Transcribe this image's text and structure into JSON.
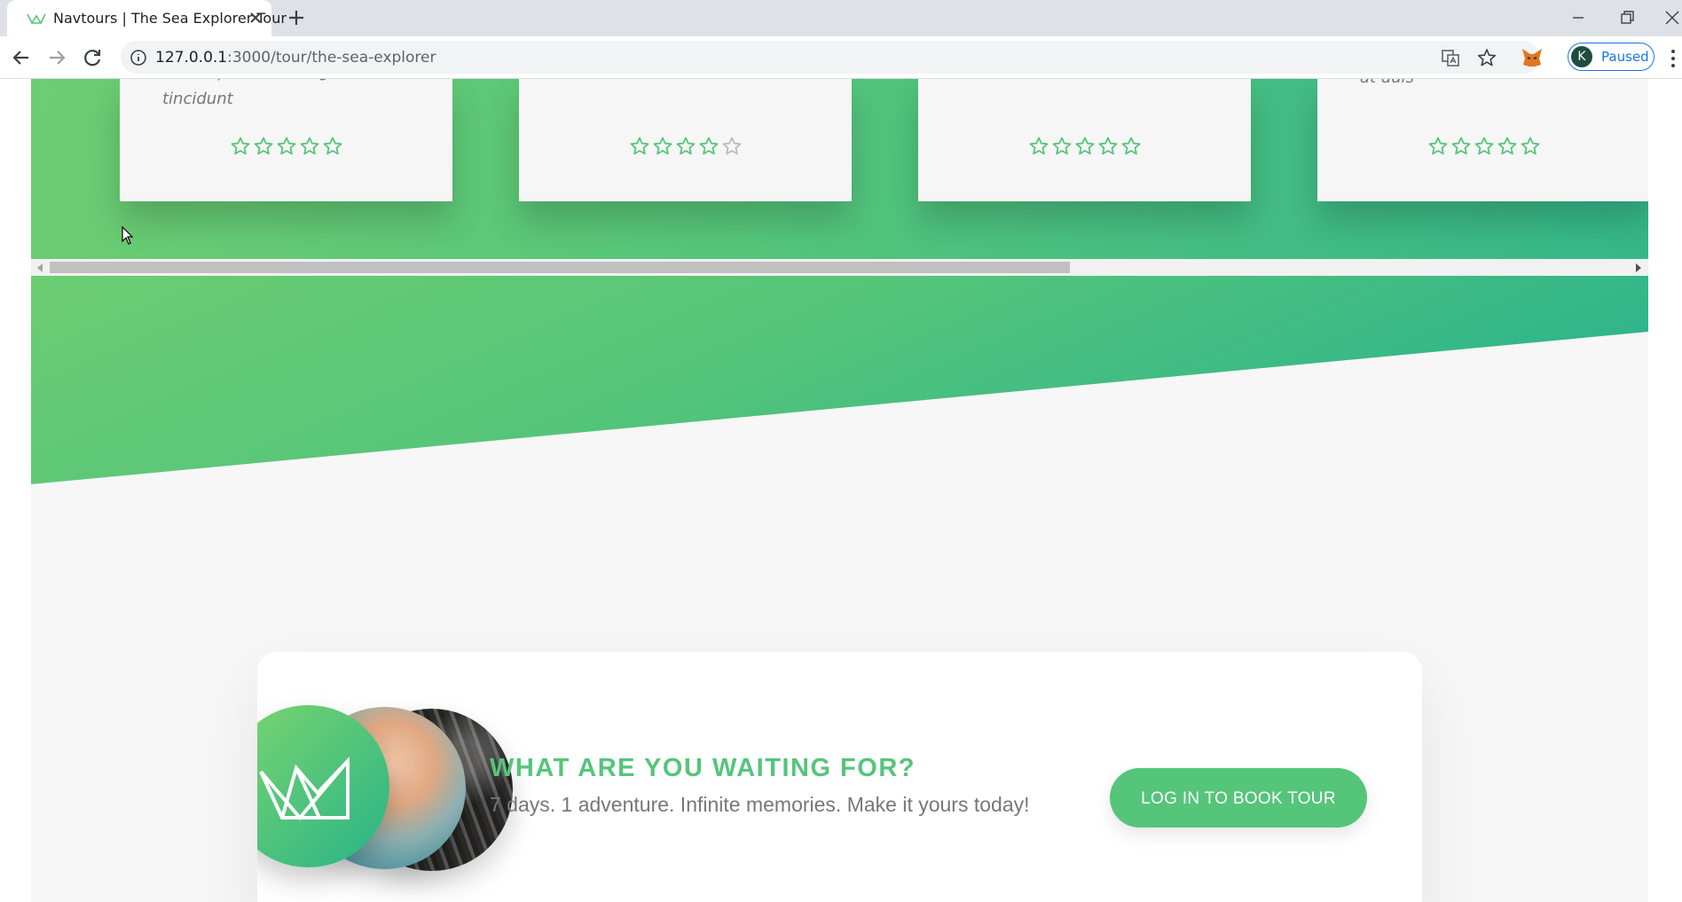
{
  "browser": {
    "tab_title": "Navtours | The Sea Explorer Tour",
    "url_host": "127.0.0.1",
    "url_path": ":3000/tour/the-sea-explorer",
    "profile_initial": "K",
    "profile_status": "Paused"
  },
  "reviews": {
    "cards": [
      {
        "text_line1": "mattis praesent feugiat sit nascetur a",
        "text_line2": "tincidunt",
        "rating": 5
      },
      {
        "text_line1": "",
        "text_line2": "",
        "rating": 4
      },
      {
        "text_line1": "",
        "text_line2": "",
        "rating": 5
      },
      {
        "text_line1": "at duis",
        "text_line2": "",
        "rating": 5
      }
    ],
    "colors": {
      "gradient_start": "#6ccd72",
      "gradient_end": "#35b78a",
      "star_active": "#55c57a",
      "star_inactive": "#bbbbbb"
    }
  },
  "cta": {
    "title": "WHAT ARE YOU WAITING FOR?",
    "text": "7 days. 1 adventure. Infinite memories. Make it yours today!",
    "button_label": "LOG IN TO BOOK TOUR",
    "accent_color": "#55c57a"
  }
}
